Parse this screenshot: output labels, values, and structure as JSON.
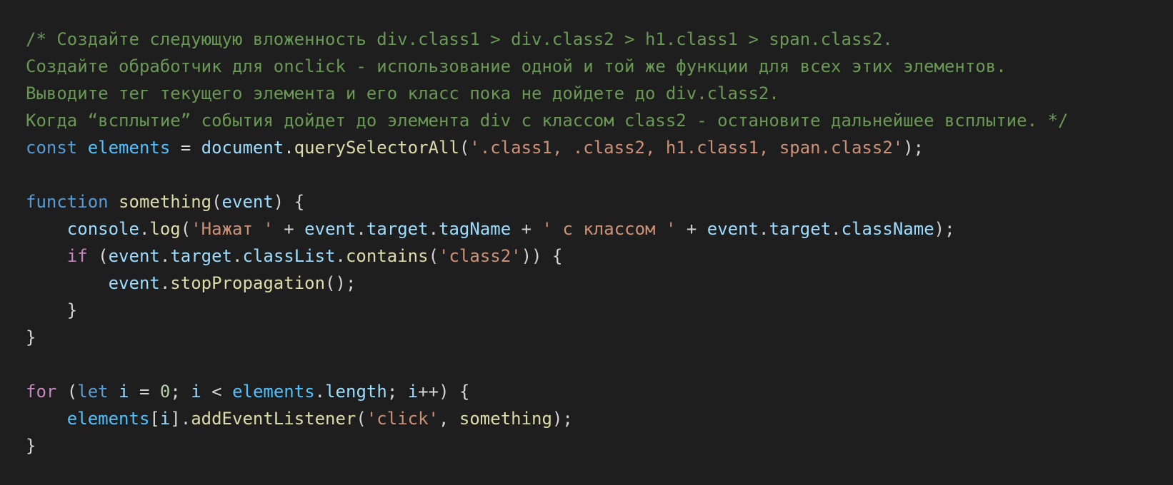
{
  "colors": {
    "background": "#1e1e1e",
    "default_text": "#d4d4d4",
    "comment": "#6a9955",
    "keyword": "#569cd6",
    "control": "#c586c0",
    "function": "#dcdcaa",
    "variable": "#9cdcfe",
    "constant": "#4fc1ff",
    "string": "#ce9178",
    "number": "#b5cea8"
  },
  "code_lines": [
    [
      {
        "t": "comment",
        "s": "/* Создайте следующую вложенность div.class1 > div.class2 > h1.class1 > span.class2."
      }
    ],
    [
      {
        "t": "comment",
        "s": "Создайте обработчик для onclick - использование одной и той же функции для всех этих элементов."
      }
    ],
    [
      {
        "t": "comment",
        "s": "Выводите тег текущего элемента и его класс пока не дойдете до div.class2."
      }
    ],
    [
      {
        "t": "comment",
        "s": "Когда “всплытие” события дойдет до элемента div с классом class2 - остановите дальнейшее всплытие. */"
      }
    ],
    [
      {
        "t": "keyword",
        "s": "const"
      },
      {
        "t": "punct",
        "s": " "
      },
      {
        "t": "const",
        "s": "elements"
      },
      {
        "t": "punct",
        "s": " = "
      },
      {
        "t": "var",
        "s": "document"
      },
      {
        "t": "punct",
        "s": "."
      },
      {
        "t": "func",
        "s": "querySelectorAll"
      },
      {
        "t": "punct",
        "s": "("
      },
      {
        "t": "string",
        "s": "'.class1, .class2, h1.class1, span.class2'"
      },
      {
        "t": "punct",
        "s": ");"
      }
    ],
    [],
    [
      {
        "t": "keyword",
        "s": "function"
      },
      {
        "t": "punct",
        "s": " "
      },
      {
        "t": "func",
        "s": "something"
      },
      {
        "t": "punct",
        "s": "("
      },
      {
        "t": "var",
        "s": "event"
      },
      {
        "t": "punct",
        "s": ") {"
      }
    ],
    [
      {
        "t": "punct",
        "s": "    "
      },
      {
        "t": "var",
        "s": "console"
      },
      {
        "t": "punct",
        "s": "."
      },
      {
        "t": "func",
        "s": "log"
      },
      {
        "t": "punct",
        "s": "("
      },
      {
        "t": "string",
        "s": "'Нажат '"
      },
      {
        "t": "punct",
        "s": " + "
      },
      {
        "t": "var",
        "s": "event"
      },
      {
        "t": "punct",
        "s": "."
      },
      {
        "t": "var",
        "s": "target"
      },
      {
        "t": "punct",
        "s": "."
      },
      {
        "t": "var",
        "s": "tagName"
      },
      {
        "t": "punct",
        "s": " + "
      },
      {
        "t": "string",
        "s": "' с классом '"
      },
      {
        "t": "punct",
        "s": " + "
      },
      {
        "t": "var",
        "s": "event"
      },
      {
        "t": "punct",
        "s": "."
      },
      {
        "t": "var",
        "s": "target"
      },
      {
        "t": "punct",
        "s": "."
      },
      {
        "t": "var",
        "s": "className"
      },
      {
        "t": "punct",
        "s": ");"
      }
    ],
    [
      {
        "t": "punct",
        "s": "    "
      },
      {
        "t": "control",
        "s": "if"
      },
      {
        "t": "punct",
        "s": " ("
      },
      {
        "t": "var",
        "s": "event"
      },
      {
        "t": "punct",
        "s": "."
      },
      {
        "t": "var",
        "s": "target"
      },
      {
        "t": "punct",
        "s": "."
      },
      {
        "t": "var",
        "s": "classList"
      },
      {
        "t": "punct",
        "s": "."
      },
      {
        "t": "func",
        "s": "contains"
      },
      {
        "t": "punct",
        "s": "("
      },
      {
        "t": "string",
        "s": "'class2'"
      },
      {
        "t": "punct",
        "s": ")) {"
      }
    ],
    [
      {
        "t": "punct",
        "s": "        "
      },
      {
        "t": "var",
        "s": "event"
      },
      {
        "t": "punct",
        "s": "."
      },
      {
        "t": "func",
        "s": "stopPropagation"
      },
      {
        "t": "punct",
        "s": "();"
      }
    ],
    [
      {
        "t": "punct",
        "s": "    }"
      }
    ],
    [
      {
        "t": "punct",
        "s": "}"
      }
    ],
    [],
    [
      {
        "t": "control",
        "s": "for"
      },
      {
        "t": "punct",
        "s": " ("
      },
      {
        "t": "keyword",
        "s": "let"
      },
      {
        "t": "punct",
        "s": " "
      },
      {
        "t": "var",
        "s": "i"
      },
      {
        "t": "punct",
        "s": " = "
      },
      {
        "t": "number",
        "s": "0"
      },
      {
        "t": "punct",
        "s": "; "
      },
      {
        "t": "var",
        "s": "i"
      },
      {
        "t": "punct",
        "s": " < "
      },
      {
        "t": "const",
        "s": "elements"
      },
      {
        "t": "punct",
        "s": "."
      },
      {
        "t": "var",
        "s": "length"
      },
      {
        "t": "punct",
        "s": "; "
      },
      {
        "t": "var",
        "s": "i"
      },
      {
        "t": "punct",
        "s": "++) {"
      }
    ],
    [
      {
        "t": "punct",
        "s": "    "
      },
      {
        "t": "const",
        "s": "elements"
      },
      {
        "t": "punct",
        "s": "["
      },
      {
        "t": "var",
        "s": "i"
      },
      {
        "t": "punct",
        "s": "]."
      },
      {
        "t": "func",
        "s": "addEventListener"
      },
      {
        "t": "punct",
        "s": "("
      },
      {
        "t": "string",
        "s": "'click'"
      },
      {
        "t": "punct",
        "s": ", "
      },
      {
        "t": "func",
        "s": "something"
      },
      {
        "t": "punct",
        "s": ");"
      }
    ],
    [
      {
        "t": "punct",
        "s": "}"
      }
    ]
  ]
}
